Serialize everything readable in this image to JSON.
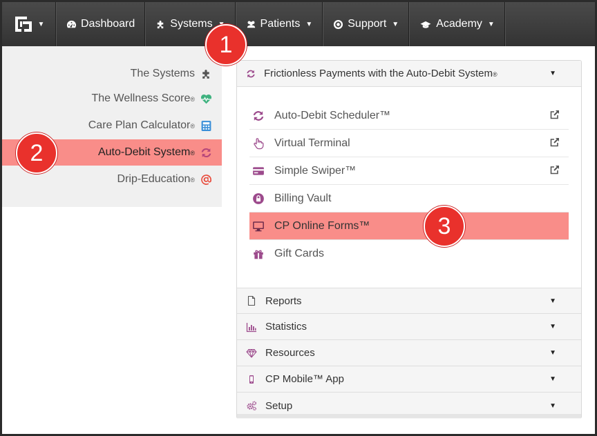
{
  "navbar": {
    "items": [
      {
        "label": "Dashboard",
        "icon": "tachometer-icon",
        "caret": false
      },
      {
        "label": "Systems",
        "icon": "puzzle-icon",
        "caret": true
      },
      {
        "label": "Patients",
        "icon": "users-icon",
        "caret": true
      },
      {
        "label": "Support",
        "icon": "life-ring-icon",
        "caret": true
      },
      {
        "label": "Academy",
        "icon": "graduation-cap-icon",
        "caret": true
      }
    ]
  },
  "sidebar": {
    "items": [
      {
        "label": "The Systems",
        "reg": "",
        "icon": "puzzle-icon",
        "color": "#555555"
      },
      {
        "label": "The Wellness Score",
        "reg": "®",
        "icon": "heartbeat-icon",
        "color": "#3fb27f"
      },
      {
        "label": "Care Plan Calculator",
        "reg": "®",
        "icon": "calculator-icon",
        "color": "#3a8fd8"
      },
      {
        "label": "Auto-Debit System",
        "reg": "®",
        "icon": "refresh-icon",
        "color": "#b5467a"
      },
      {
        "label": "Drip-Education",
        "reg": "®",
        "icon": "at-icon",
        "color": "#e84b3c"
      }
    ]
  },
  "panel": {
    "header": {
      "label": "Frictionless Payments with the Auto-Debit System",
      "reg": "®"
    },
    "sub_items": [
      {
        "label": "Auto-Debit Scheduler™",
        "icon": "refresh-icon",
        "external": true
      },
      {
        "label": "Virtual Terminal",
        "icon": "hand-pointer-icon",
        "external": true
      },
      {
        "label": "Simple Swiper™",
        "icon": "credit-card-icon",
        "external": true
      },
      {
        "label": "Billing Vault",
        "icon": "lock-icon",
        "external": false
      },
      {
        "label": "CP Online Forms™",
        "icon": "desktop-icon",
        "external": false
      },
      {
        "label": "Gift Cards",
        "icon": "gift-icon",
        "external": false
      }
    ],
    "sections": [
      {
        "label": "Reports",
        "icon": "file-icon"
      },
      {
        "label": "Statistics",
        "icon": "bar-chart-icon"
      },
      {
        "label": "Resources",
        "icon": "diamond-icon"
      },
      {
        "label": "CP Mobile™ App",
        "icon": "mobile-icon"
      },
      {
        "label": "Setup",
        "icon": "cogs-icon"
      }
    ]
  },
  "callouts": [
    "1",
    "2",
    "3"
  ],
  "colors": {
    "navbar": "#3a3a3a",
    "highlight": "#f98d89",
    "callout": "#e9312c",
    "accent_purple": "#9c4a8c"
  }
}
